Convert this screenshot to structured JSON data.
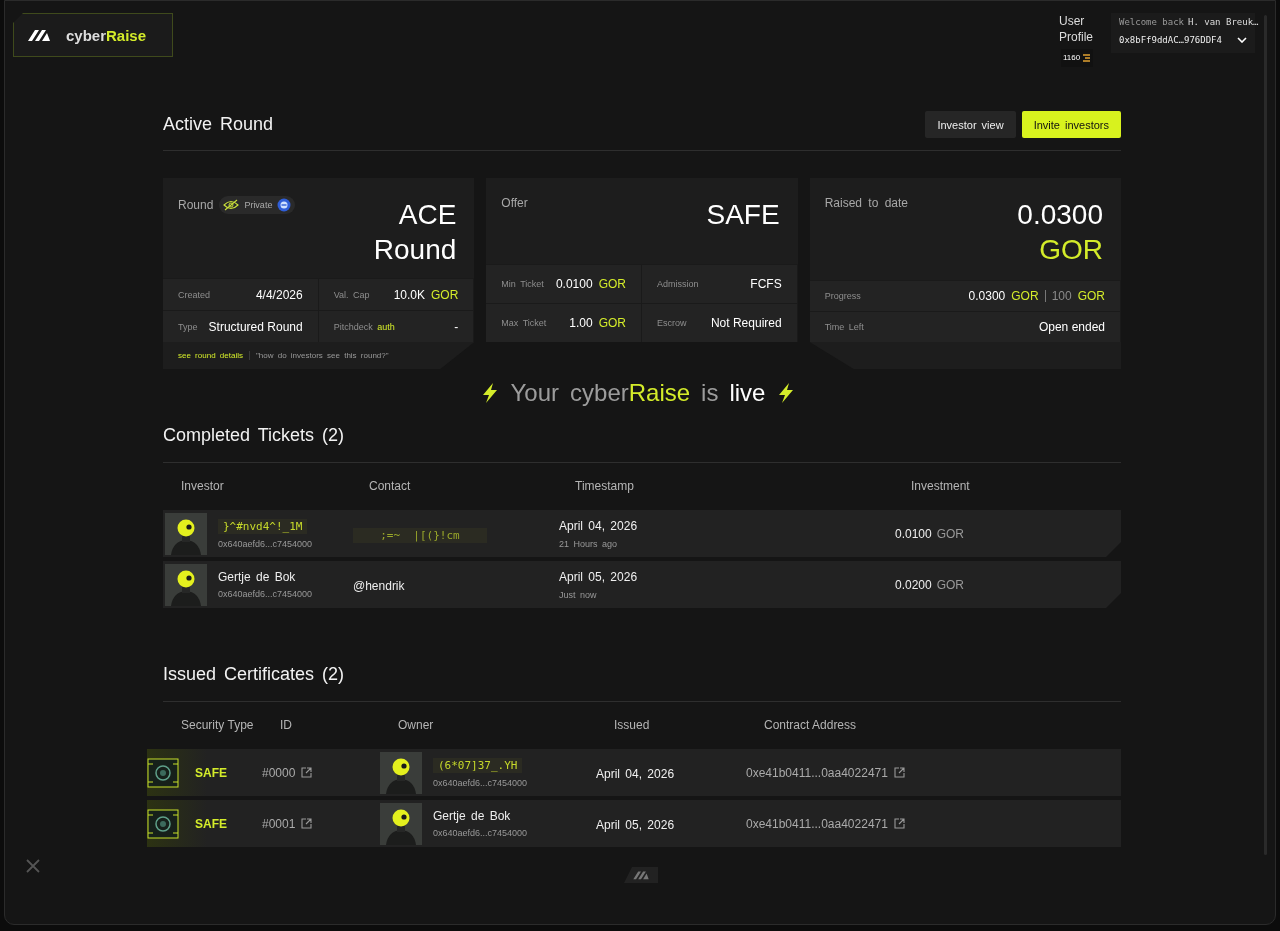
{
  "header": {
    "brand": {
      "prefix": "cyber",
      "accent": "Raise"
    },
    "profile": {
      "image_alt": "User Profile",
      "points": "1160",
      "welcome": "Welcome back",
      "user": "H. van Breuk…",
      "address": "0x8bFf9ddAC…976DDF4"
    }
  },
  "round": {
    "title": "Active Round",
    "buttons": [
      {
        "label": "Investor view",
        "kind": "secondary"
      },
      {
        "label": "Invite investors",
        "kind": "primary"
      }
    ],
    "cards": [
      {
        "kind": "grid",
        "label": "Round",
        "badge": {
          "label": "Private"
        },
        "title": {
          "text": "ACE Round"
        },
        "fields": [
          {
            "label": "Created",
            "value": {
              "text": "4/4/2026"
            }
          },
          {
            "label": "Val. Cap",
            "value": {
              "text": "10.0K",
              "unit": "GOR"
            }
          },
          {
            "label": "Type",
            "value": {
              "text": "Structured Round"
            }
          },
          {
            "label": "Pitchdeck",
            "label_accent": "auth",
            "value": {
              "text": "-"
            }
          }
        ],
        "links": [
          {
            "text": "see round details",
            "kind": "link"
          },
          {
            "text": "\"how do investors see this round?\"",
            "kind": "quote"
          }
        ]
      },
      {
        "kind": "grid",
        "label": "Offer",
        "title": {
          "text": "SAFE"
        },
        "fields": [
          {
            "label": "Min Ticket",
            "value": {
              "text": "0.0100",
              "unit": "GOR"
            }
          },
          {
            "label": "Admission",
            "value": {
              "text": "FCFS"
            }
          },
          {
            "label": "Max Ticket",
            "value": {
              "text": "1.00",
              "unit": "GOR"
            }
          },
          {
            "label": "Escrow",
            "value": {
              "text": "Not Required"
            }
          }
        ]
      },
      {
        "kind": "list",
        "label": "Raised to date",
        "title": {
          "text": "0.0300",
          "unit": "GOR"
        },
        "fields": [
          {
            "label": "Progress",
            "value": {
              "text": "0.0300",
              "unit": "GOR",
              "target": "100",
              "target_unit": "GOR"
            }
          },
          {
            "label": "Time Left",
            "value": {
              "text": "Open ended"
            }
          }
        ]
      }
    ]
  },
  "banner": {
    "lead": "Your",
    "brand_prefix": "cyber",
    "brand_accent": "Raise",
    "middle": "is",
    "state": "live"
  },
  "tickets": {
    "title": "Completed Tickets (2)",
    "columns": [
      "Investor",
      "Contact",
      "Timestamp",
      "Investment"
    ],
    "rows": [
      {
        "investor": {
          "name": "}^#nvd4^!_1M",
          "kind": "scrambled",
          "address": "0x640aefd6...c7454000"
        },
        "contact": {
          "text": ";=~  |[(}!cm",
          "kind": "scrambled"
        },
        "date": "April 04, 2026",
        "relative": "21 Hours ago",
        "amount": "0.0100",
        "unit": "GOR"
      },
      {
        "investor": {
          "name": "Gertje de Bok",
          "kind": "plain",
          "address": "0x640aefd6...c7454000"
        },
        "contact": {
          "text": "@hendrik",
          "kind": "plain"
        },
        "date": "April 05, 2026",
        "relative": "Just now",
        "amount": "0.0200",
        "unit": "GOR"
      }
    ]
  },
  "certificates": {
    "title": "Issued Certificates (2)",
    "columns": [
      "Security Type",
      "ID",
      "Owner",
      "Issued",
      "Contract Address"
    ],
    "rows": [
      {
        "type": "SAFE",
        "id": "#0000",
        "owner": {
          "name": "(6*07]37_.YH",
          "kind": "scrambled",
          "address": "0x640aefd6...c7454000"
        },
        "issued": "April 04, 2026",
        "contract": "0xe41b0411...0aa4022471"
      },
      {
        "type": "SAFE",
        "id": "#0001",
        "owner": {
          "name": "Gertje de Bok",
          "kind": "plain",
          "address": "0x640aefd6...c7454000"
        },
        "issued": "April 05, 2026",
        "contract": "0xe41b0411...0aa4022471"
      }
    ]
  }
}
